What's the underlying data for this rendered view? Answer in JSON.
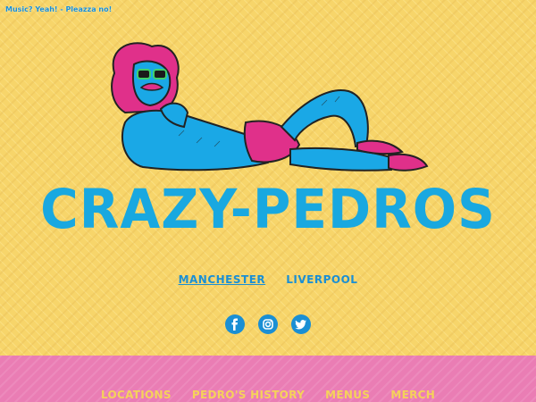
{
  "music_toggle": "Music? Yeah! - Pleazza no!",
  "logo_text": "CRAZY-PEDROS",
  "locations": [
    {
      "label": "MANCHESTER"
    },
    {
      "label": "LIVERPOOL"
    }
  ],
  "social": [
    "facebook-icon",
    "instagram-icon",
    "twitter-icon"
  ],
  "footer_nav": [
    {
      "label": "LOCATIONS"
    },
    {
      "label": "PEDRO'S HISTORY"
    },
    {
      "label": "MENUS"
    },
    {
      "label": "MERCH"
    }
  ],
  "colors": {
    "background": "#f7d56a",
    "footer": "#ea7db4",
    "accent_blue": "#19a8e0",
    "magenta": "#e0308a",
    "nav_yellow": "#f5d25a"
  }
}
